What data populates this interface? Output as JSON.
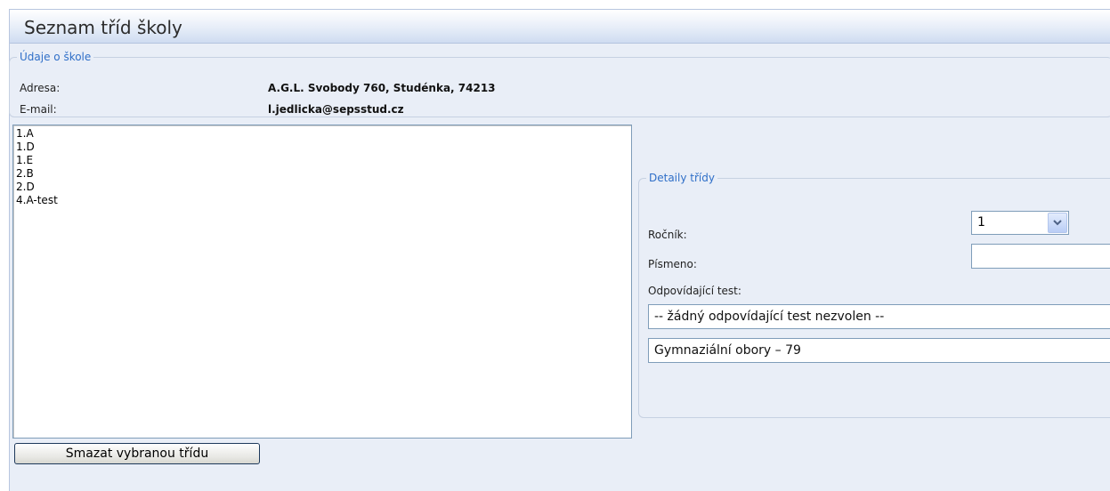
{
  "header": {
    "title": "Seznam tříd školy"
  },
  "school": {
    "legend": "Údaje o škole",
    "address_label": "Adresa:",
    "address_value": "A.G.L. Svobody 760, Studénka, 74213",
    "email_label": "E-mail:",
    "email_value": "l.jedlicka@sepsstud.cz"
  },
  "classes": [
    "1.A",
    "1.D",
    "1.E",
    "2.B",
    "2.D",
    "4.A-test"
  ],
  "delete_button_label": "Smazat vybranou třídu",
  "details": {
    "legend": "Detaily třídy",
    "year_label": "Ročník:",
    "year_value": "1",
    "letter_label": "Písmeno:",
    "letter_value": "",
    "test_label": "Odpovídající test:",
    "test_value": "-- žádný odpovídající test nezvolen --",
    "program_value": "Gymnaziální obory – 79"
  }
}
